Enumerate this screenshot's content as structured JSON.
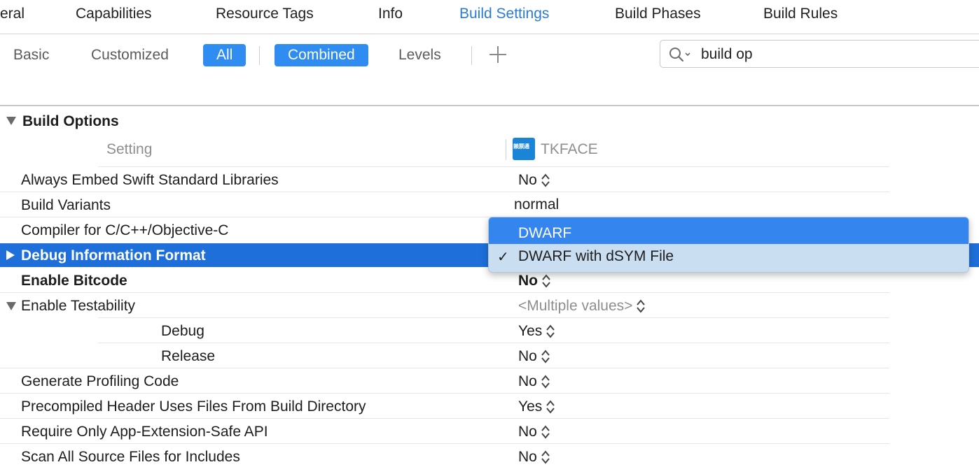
{
  "top_tabs": [
    {
      "label": "eral"
    },
    {
      "label": "Capabilities"
    },
    {
      "label": "Resource Tags"
    },
    {
      "label": "Info"
    },
    {
      "label": "Build Settings",
      "active": true
    },
    {
      "label": "Build Phases"
    },
    {
      "label": "Build Rules"
    }
  ],
  "filter": {
    "scope": [
      "Basic",
      "Customized",
      "All"
    ],
    "scope_selected": "All",
    "view": [
      "Combined",
      "Levels"
    ],
    "view_selected": "Combined"
  },
  "search": {
    "value": "build op"
  },
  "section": {
    "title": "Build Options"
  },
  "header": {
    "setting": "Setting",
    "target": "TKFACE",
    "target_icon_text": "赖票通"
  },
  "rows": [
    {
      "label": "Always Embed Swift Standard Libraries",
      "value": "No"
    },
    {
      "label": "Build Variants",
      "value": "normal"
    },
    {
      "label": "Compiler for C/C++/Objective-C",
      "value": ""
    },
    {
      "label": "Debug Information Format",
      "value": "DWARF with dSYM File"
    },
    {
      "label": "Enable Bitcode",
      "value": "No"
    },
    {
      "label": "Enable Testability",
      "value": "<Multiple values>"
    },
    {
      "label": "Debug",
      "value": "Yes"
    },
    {
      "label": "Release",
      "value": "No"
    },
    {
      "label": "Generate Profiling Code",
      "value": "No"
    },
    {
      "label": "Precompiled Header Uses Files From Build Directory",
      "value": "Yes"
    },
    {
      "label": "Require Only App-Extension-Safe API",
      "value": "No"
    },
    {
      "label": "Scan All Source Files for Includes",
      "value": "No"
    }
  ],
  "popup": {
    "items": [
      "DWARF",
      "DWARF with dSYM File"
    ],
    "highlighted": "DWARF",
    "checked": "DWARF with dSYM File",
    "check_mark": "✓"
  },
  "colors": {
    "accent": "#2a7bd7",
    "selection": "#1e6fd9",
    "menu_highlight": "#3485ee"
  }
}
